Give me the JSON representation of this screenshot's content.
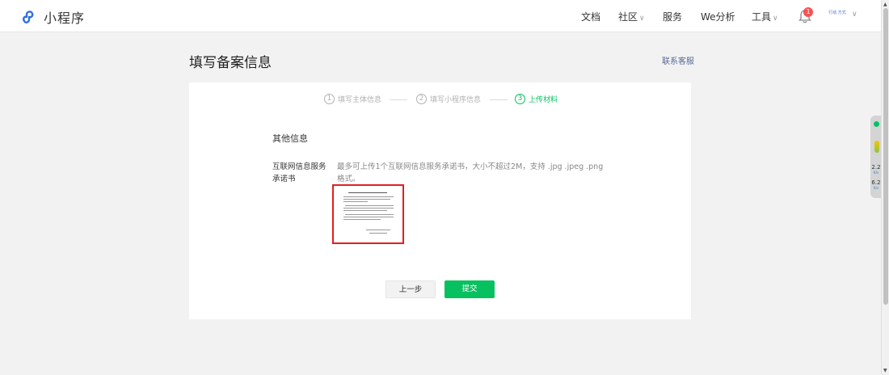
{
  "app": {
    "title": "小程序",
    "logo_icon": "miniprogram-logo-icon"
  },
  "nav": {
    "docs": "文档",
    "community": "社区",
    "services": "服务",
    "analytics": "We分析",
    "tools": "工具",
    "notification_count": "1",
    "avatar_text": "行动 方式"
  },
  "page": {
    "title": "填写备案信息",
    "contact": "联系客服"
  },
  "stepper": [
    {
      "num": "1",
      "label": "填写主体信息",
      "state": "done"
    },
    {
      "num": "2",
      "label": "填写小程序信息",
      "state": "done"
    },
    {
      "num": "3",
      "label": "上传材料",
      "state": "active"
    }
  ],
  "form": {
    "section_title": "其他信息",
    "field_label": "互联网信息服务承诺书",
    "field_hint": "最多可上传1个互联网信息服务承诺书，大小不超过2M，支持 .jpg .jpeg .png 格式。"
  },
  "buttons": {
    "prev": "上一步",
    "submit": "提交"
  },
  "side_widget": {
    "stat1": "2.2",
    "unit1": "K/s",
    "stat2": "6.2",
    "unit2": "K/s"
  },
  "colors": {
    "accent": "#07c160",
    "highlight": "#e02020",
    "link": "#576b95",
    "badge": "#fa5151"
  }
}
